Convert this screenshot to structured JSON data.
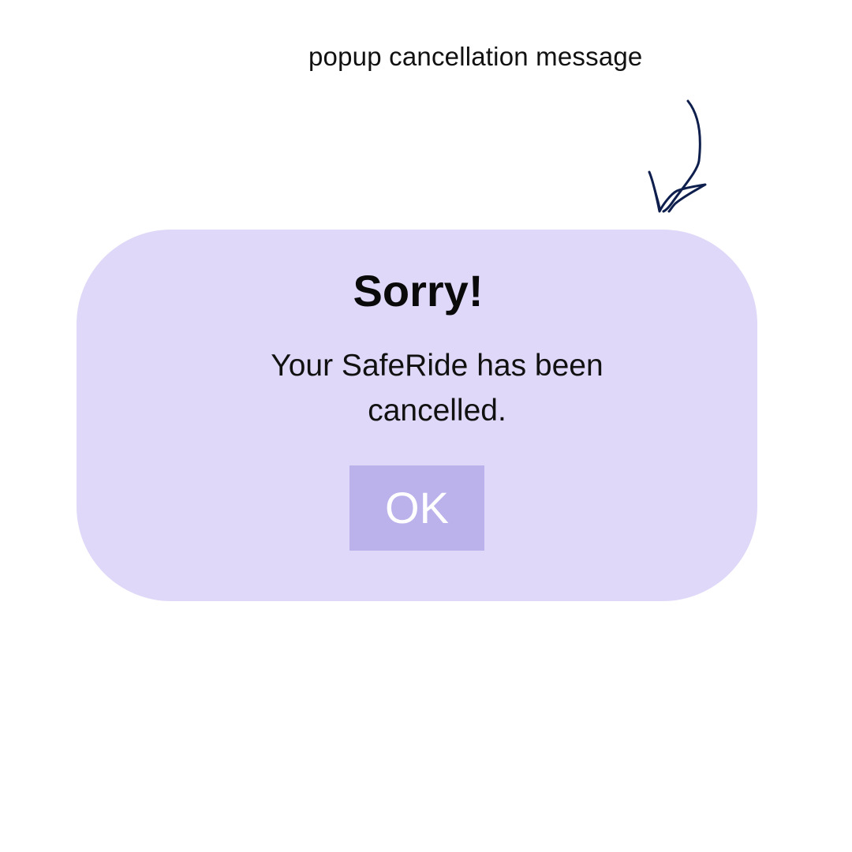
{
  "annotation": {
    "caption": "popup cancellation message",
    "arrow_color": "#0f1f4d"
  },
  "dialog": {
    "title": "Sorry!",
    "message": "Your SafeRide has been cancelled.",
    "ok_label": "OK",
    "background_color": "#dfd8f8",
    "button_color": "#bbb2ec"
  }
}
